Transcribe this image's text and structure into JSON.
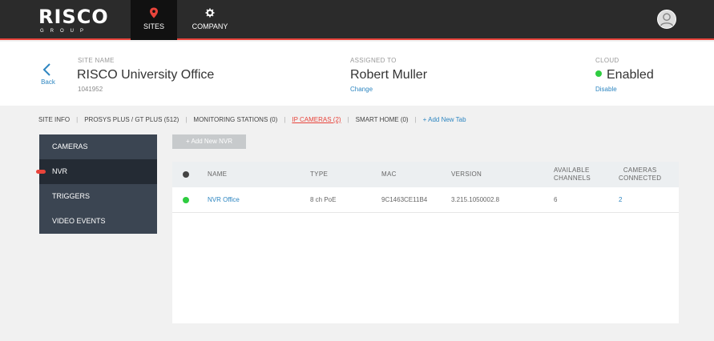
{
  "brand": {
    "name": "RISCO",
    "sub": "GROUP",
    "accent": "#e8443b"
  },
  "nav": {
    "sites_label": "SITES",
    "company_label": "COMPANY"
  },
  "header": {
    "back_label": "Back",
    "site_name_label": "SITE NAME",
    "site_name": "RISCO University Office",
    "site_id": "1041952",
    "assigned_label": "ASSIGNED TO",
    "assigned_to": "Robert Muller",
    "change_label": "Change",
    "cloud_label": "CLOUD",
    "cloud_status": "Enabled",
    "cloud_status_color": "#2ecc40",
    "disable_label": "Disable"
  },
  "tabs": [
    {
      "label": "SITE INFO"
    },
    {
      "label": "PROSYS PLUS / GT PLUS (512)"
    },
    {
      "label": "MONITORING STATIONS (0)"
    },
    {
      "label": "IP CAMERAS (2)",
      "active": true
    },
    {
      "label": "SMART HOME (0)"
    },
    {
      "label": "+ Add New Tab"
    }
  ],
  "sidemenu": {
    "items": [
      {
        "label": "CAMERAS"
      },
      {
        "label": "NVR",
        "active": true
      },
      {
        "label": "TRIGGERS"
      },
      {
        "label": "VIDEO EVENTS"
      }
    ]
  },
  "add_nvr_label": "+ Add New NVR",
  "table": {
    "headers": {
      "name": "NAME",
      "type": "TYPE",
      "mac": "MAC",
      "version": "VERSION",
      "available_line1": "AVAILABLE",
      "available_line2": "CHANNELS",
      "connected_line1": "CAMERAS",
      "connected_line2": "CONNECTED"
    },
    "rows": [
      {
        "status_color": "#2ecc40",
        "name": "NVR Office",
        "type": "8 ch PoE",
        "mac": "9C1463CE11B4",
        "version": "3.215.1050002.8",
        "available_channels": "6",
        "cameras_connected": "2"
      }
    ]
  }
}
